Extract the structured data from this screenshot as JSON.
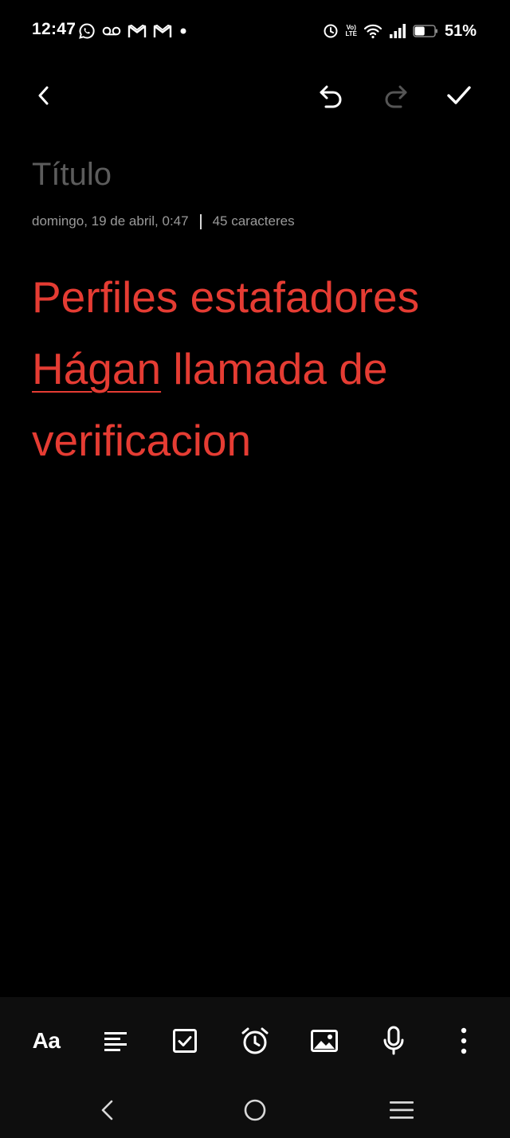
{
  "status_bar": {
    "time": "12:47",
    "left_icons": [
      "whatsapp-icon",
      "voicemail-icon",
      "gmail-icon",
      "gmail-icon",
      "dot-icon"
    ],
    "right_icons": [
      "alarm-icon",
      "volte-icon",
      "wifi-icon",
      "signal-icon",
      "battery-icon"
    ],
    "volte_top": "Vo)",
    "volte_bottom": "LTE",
    "battery_percent": "51%",
    "battery_level": 0.51
  },
  "toolbar": {
    "back_icon": "chevron-left-icon",
    "undo_icon": "undo-icon",
    "redo_icon": "redo-icon",
    "done_icon": "check-icon"
  },
  "note": {
    "title_placeholder": "Título",
    "date": "domingo, 19 de abril, 0:47",
    "char_count": "45 caracteres",
    "body_line1": "Perfiles estafadores",
    "body_line2_underlined": "Hágan",
    "body_line2_rest": " llamada de",
    "body_line3": "verificacion"
  },
  "format_bar": {
    "text_style_label": "Aa",
    "icons": [
      "text-style-icon",
      "align-left-icon",
      "checkbox-icon",
      "alarm-clock-icon",
      "image-icon",
      "microphone-icon",
      "more-vertical-icon"
    ]
  },
  "nav_bar": {
    "icons": [
      "nav-back-icon",
      "nav-home-icon",
      "nav-recents-icon"
    ]
  },
  "colors": {
    "background": "#000000",
    "body_text": "#e53c33",
    "title_placeholder": "#5c5c5c",
    "meta_text": "#9a9a9a",
    "bottom_bar": "#0e0e0e",
    "disabled_icon": "#555555"
  }
}
